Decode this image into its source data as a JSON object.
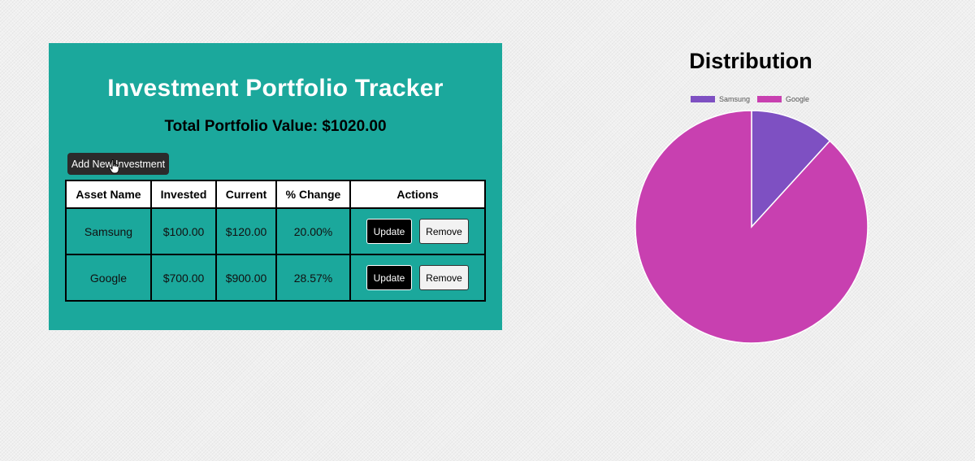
{
  "app": {
    "title": "Investment Portfolio Tracker",
    "total_value": "Total Portfolio Value: $1020.00",
    "add_button": "Add New Investment"
  },
  "table": {
    "headers": [
      "Asset Name",
      "Invested",
      "Current",
      "% Change",
      "Actions"
    ],
    "rows": [
      {
        "name": "Samsung",
        "invested": "$100.00",
        "current": "$120.00",
        "change": "20.00%",
        "update": "Update",
        "remove": "Remove"
      },
      {
        "name": "Google",
        "invested": "$700.00",
        "current": "$900.00",
        "change": "28.57%",
        "update": "Update",
        "remove": "Remove"
      }
    ]
  },
  "chart_title": "Distribution",
  "chart_data": {
    "type": "pie",
    "title": "Distribution",
    "categories": [
      "Samsung",
      "Google"
    ],
    "values": [
      120,
      900
    ],
    "colors": [
      "#7e50c2",
      "#c840b0"
    ],
    "legend_position": "top"
  },
  "icons": {
    "cursor": "hand-pointer-icon"
  }
}
